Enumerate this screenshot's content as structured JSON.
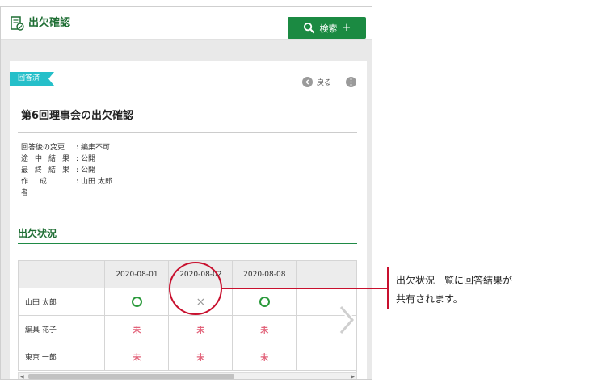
{
  "header": {
    "title": "出欠確認",
    "search_label": "検索",
    "search_plus": "+"
  },
  "card": {
    "status": "回答済",
    "back_label": "戻る",
    "title": "第6回理事会の出欠確認",
    "meta": [
      {
        "key": "回答後の変更",
        "sep": ":",
        "value": "編集不可"
      },
      {
        "key": "途中結果",
        "sep": ":",
        "value": "公開"
      },
      {
        "key": "最終結果",
        "sep": ":",
        "value": "公開"
      },
      {
        "key": "作成者",
        "sep": ":",
        "value": "山田 太郎"
      }
    ],
    "section_title": "出欠状況"
  },
  "table": {
    "dates": [
      "2020-08-01",
      "2020-08-02",
      "2020-08-08"
    ],
    "rows": [
      {
        "name": "山田 太郎",
        "cells": [
          "ok",
          "ng",
          "ok"
        ]
      },
      {
        "name": "編具 花子",
        "cells": [
          "pending",
          "pending",
          "pending"
        ]
      },
      {
        "name": "東京 一郎",
        "cells": [
          "pending",
          "pending",
          "pending"
        ]
      }
    ],
    "ng_symbol": "×",
    "pending_symbol": "未"
  },
  "callout": {
    "line1": "出欠状況一覧に回答結果が",
    "line2": "共有されます。"
  },
  "colors": {
    "brand_green": "#1b8a42",
    "ribbon": "#25bfc9",
    "accent_red": "#c8102e",
    "pending": "#e2637a"
  }
}
